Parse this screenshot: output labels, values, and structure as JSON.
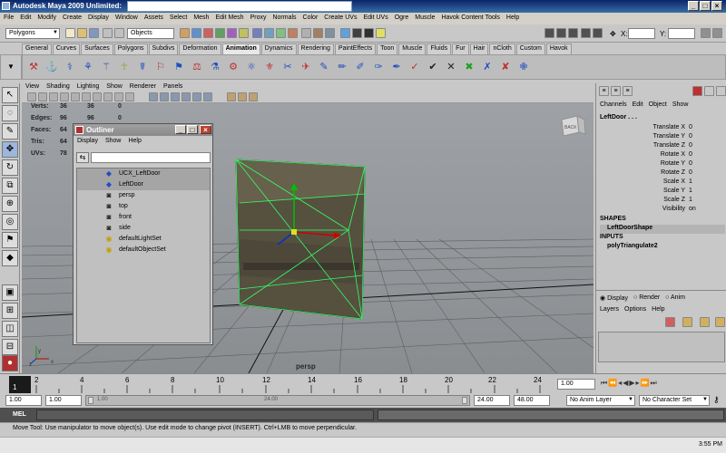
{
  "window": {
    "title": "Autodesk Maya 2009 Unlimited:"
  },
  "menubar": [
    "File",
    "Edit",
    "Modify",
    "Create",
    "Display",
    "Window",
    "Assets",
    "Select",
    "Mesh",
    "Edit Mesh",
    "Proxy",
    "Normals",
    "Color",
    "Create UVs",
    "Edit UVs",
    "Ogre",
    "Muscle",
    "Havok Content Tools",
    "Help"
  ],
  "statusline": {
    "menu_set": "Polygons",
    "selection_field": "Objects",
    "x_label": "X:",
    "y_label": "Y:"
  },
  "shelf_tabs": [
    "General",
    "Curves",
    "Surfaces",
    "Polygons",
    "Subdivs",
    "Deformation",
    "Animation",
    "Dynamics",
    "Rendering",
    "PaintEffects",
    "Toon",
    "Muscle",
    "Fluids",
    "Fur",
    "Hair",
    "nCloth",
    "Custom",
    "Havok"
  ],
  "shelf_active_tab": "Animation",
  "panel_menu": [
    "View",
    "Shading",
    "Lighting",
    "Show",
    "Renderer",
    "Panels"
  ],
  "hud": [
    {
      "label": "Verts:",
      "a": "36",
      "b": "36",
      "c": "0"
    },
    {
      "label": "Edges:",
      "a": "96",
      "b": "96",
      "c": "0"
    },
    {
      "label": "Faces:",
      "a": "64",
      "b": "64",
      "c": "0"
    },
    {
      "label": "Tris:",
      "a": "64",
      "b": "64",
      "c": "0"
    },
    {
      "label": "UVs:",
      "a": "78",
      "b": "78",
      "c": "0"
    }
  ],
  "view_cube_label": "BACK",
  "camera_label": "persp",
  "outliner": {
    "title": "Outliner",
    "menu": [
      "Display",
      "Show",
      "Help"
    ],
    "items": [
      {
        "label": "UCX_LeftDoor",
        "icon": "mesh-icon",
        "selected": true
      },
      {
        "label": "LeftDoor",
        "icon": "mesh-icon",
        "selected": true
      },
      {
        "label": "persp",
        "icon": "camera-icon",
        "selected": false
      },
      {
        "label": "top",
        "icon": "camera-icon",
        "selected": false
      },
      {
        "label": "front",
        "icon": "camera-icon",
        "selected": false
      },
      {
        "label": "side",
        "icon": "camera-icon",
        "selected": false
      },
      {
        "label": "defaultLightSet",
        "icon": "set-icon",
        "selected": false
      },
      {
        "label": "defaultObjectSet",
        "icon": "set-icon",
        "selected": false
      }
    ]
  },
  "channel_box": {
    "menu": [
      "Channels",
      "Edit",
      "Object",
      "Show"
    ],
    "object_name": "LeftDoor . . .",
    "channels": [
      {
        "name": "Translate X",
        "value": "0"
      },
      {
        "name": "Translate Y",
        "value": "0"
      },
      {
        "name": "Translate Z",
        "value": "0"
      },
      {
        "name": "Rotate X",
        "value": "0"
      },
      {
        "name": "Rotate Y",
        "value": "0"
      },
      {
        "name": "Rotate Z",
        "value": "0"
      },
      {
        "name": "Scale X",
        "value": "1"
      },
      {
        "name": "Scale Y",
        "value": "1"
      },
      {
        "name": "Scale Z",
        "value": "1"
      },
      {
        "name": "Visibility",
        "value": "on"
      }
    ],
    "shapes_header": "SHAPES",
    "shape_name": "LeftDoorShape",
    "inputs_header": "INPUTS",
    "input_name": "polyTriangulate2"
  },
  "layer_editor": {
    "radios": [
      "Display",
      "Render",
      "Anim"
    ],
    "menu": [
      "Layers",
      "Options",
      "Help"
    ]
  },
  "timeline": {
    "ticks": [
      "1",
      "2",
      "4",
      "6",
      "8",
      "10",
      "12",
      "14",
      "16",
      "18",
      "20",
      "22",
      "24"
    ],
    "current_frame": "1.00"
  },
  "range": {
    "start": "1.00",
    "playback_start": "1.00",
    "slider_start": "1.00",
    "slider_end": "24.00",
    "playback_end": "24.00",
    "end": "48.00",
    "anim_layer": "No Anim Layer",
    "character_set": "No Character Set"
  },
  "mel_label": "MEL",
  "help_line": "Move Tool: Use manipulator to move object(s). Use edit mode to change pivot (INSERT). Ctrl+LMB to move perpendicular.",
  "clock": "3:55 PM"
}
